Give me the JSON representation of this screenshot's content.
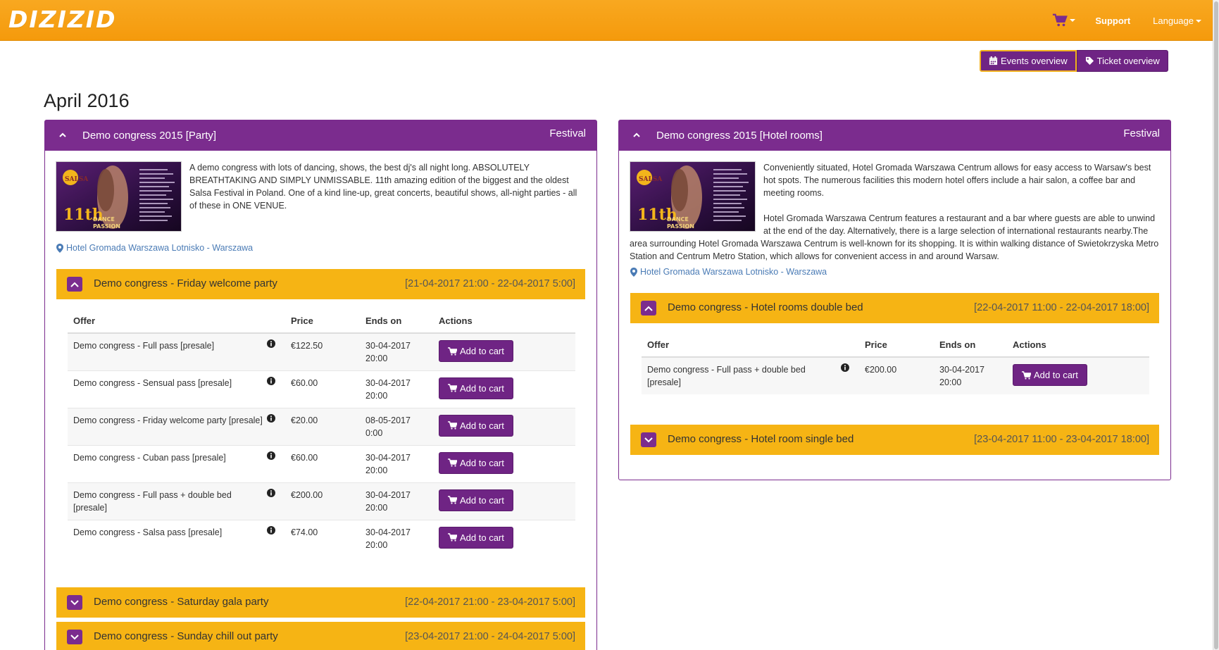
{
  "nav": {
    "logo": "DIZIZID",
    "support": "Support",
    "language": "Language"
  },
  "actions": {
    "events_overview": "Events overview",
    "ticket_overview": "Ticket overview"
  },
  "month": "April 2016",
  "left": {
    "title": "Demo congress 2015 [Party]",
    "type": "Festival",
    "description": "A demo congress with lots of dancing, shows, the best dj's all night long. ABSOLUTELY BREATHTAKING AND SIMPLY UNMISSABLE. 11th amazing edition of the biggest and the oldest Salsa Festival in Poland. One of a kind line-up, great concerts, beautiful shows, all-night parties - all of these in ONE VENUE.",
    "location": "Hotel Gromada Warszawa Lotnisko - Warszawa",
    "sub1": {
      "title": "Demo congress - Friday welcome party",
      "dates": "[21-04-2017 21:00 - 22-04-2017 5:00]"
    },
    "columns": [
      "Offer",
      "Price",
      "Ends on",
      "Actions"
    ],
    "rows": [
      {
        "offer": "Demo congress - Full pass [presale]",
        "price": "€122.50",
        "ends1": "30-04-2017",
        "ends2": "20:00",
        "action": "Add to cart"
      },
      {
        "offer": "Demo congress - Sensual pass [presale]",
        "price": "€60.00",
        "ends1": "30-04-2017",
        "ends2": "20:00",
        "action": "Add to cart"
      },
      {
        "offer": "Demo congress - Friday welcome party [presale]",
        "price": "€20.00",
        "ends1": "08-05-2017",
        "ends2": "0:00",
        "action": "Add to cart"
      },
      {
        "offer": "Demo congress - Cuban pass [presale]",
        "price": "€60.00",
        "ends1": "30-04-2017",
        "ends2": "20:00",
        "action": "Add to cart"
      },
      {
        "offer": "Demo congress - Full pass + double bed [presale]",
        "price": "€200.00",
        "ends1": "30-04-2017",
        "ends2": "20:00",
        "action": "Add to cart"
      },
      {
        "offer": "Demo congress - Salsa pass [presale]",
        "price": "€74.00",
        "ends1": "30-04-2017",
        "ends2": "20:00",
        "action": "Add to cart"
      }
    ],
    "sub2": {
      "title": "Demo congress - Saturday gala party",
      "dates": "[22-04-2017 21:00 - 23-04-2017 5:00]"
    },
    "sub3": {
      "title": "Demo congress - Sunday chill out party",
      "dates": "[23-04-2017 21:00 - 24-04-2017 5:00]"
    }
  },
  "right": {
    "title": "Demo congress 2015 [Hotel rooms]",
    "type": "Festival",
    "description1": "Conveniently situated, Hotel Gromada Warszawa Centrum allows for easy access to Warsaw's best hot spots. The numerous facilities this modern hotel offers include a hair salon, a coffee bar and meeting rooms.",
    "description2": "Hotel Gromada Warszawa Centrum features a restaurant and a bar where guests are able to unwind at the end of the day. Alternatively, there is a large selection of international restaurants nearby.The area surrounding Hotel Gromada Warszawa Centrum is well-known for its shopping. It is within walking distance of Swietokrzyska Metro Station and Centrum Metro Station, which allows for convenient access in and around Warsaw.",
    "location": "Hotel Gromada Warszawa Lotnisko - Warszawa",
    "sub1": {
      "title": "Demo congress - Hotel rooms double bed",
      "dates": "[22-04-2017 11:00 - 22-04-2017 18:00]"
    },
    "columns": [
      "Offer",
      "Price",
      "Ends on",
      "Actions"
    ],
    "rows": [
      {
        "offer": "Demo congress - Full pass + double bed [presale]",
        "price": "€200.00",
        "ends1": "30-04-2017",
        "ends2": "20:00",
        "action": "Add to cart"
      }
    ],
    "sub2": {
      "title": "Demo congress - Hotel room single bed",
      "dates": "[23-04-2017 11:00 - 23-04-2017 18:00]"
    }
  },
  "image_banner": {
    "brand": "SALSA FESTIVAL",
    "edition": "11th",
    "line1": "DANCE",
    "line2": "PASSION",
    "city": "Warsaw"
  },
  "colors": {
    "purple": "#7b2c8e",
    "orange": "#f6b414",
    "nav_orange": "#f7a11a",
    "link": "#4a7bb5"
  }
}
